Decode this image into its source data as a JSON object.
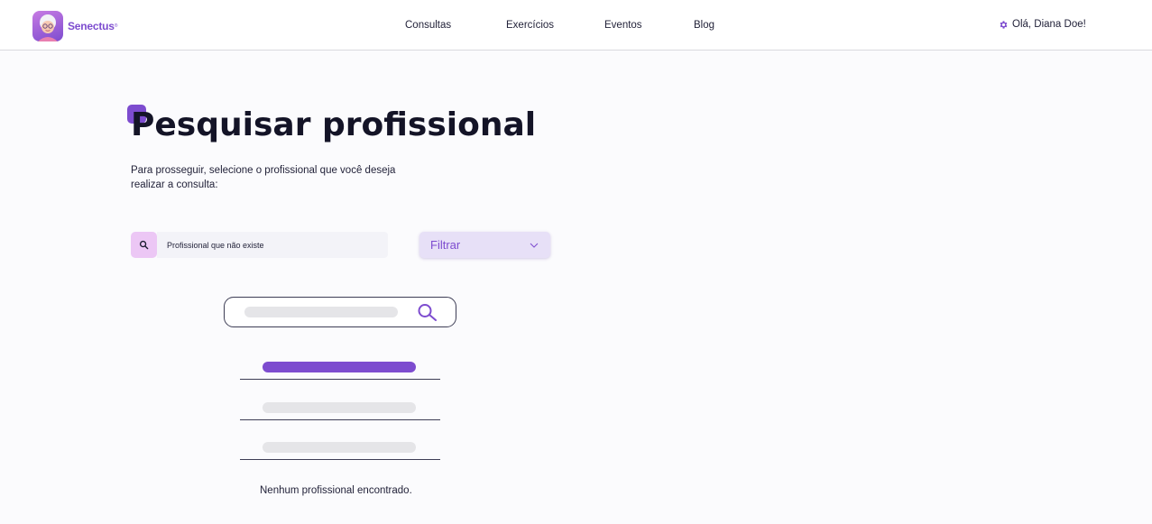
{
  "brand": {
    "name": "Senectus",
    "trademark": "®"
  },
  "nav": {
    "items": [
      {
        "label": "Consultas"
      },
      {
        "label": "Exercícios"
      },
      {
        "label": "Eventos"
      },
      {
        "label": "Blog"
      }
    ],
    "greeting": "Olá, Diana Doe!"
  },
  "page": {
    "title": "Pesquisar profissional",
    "subtitle": "Para prosseguir, selecione o profissional que você deseja realizar a consulta:"
  },
  "search": {
    "value": "Profissional que não existe",
    "icon": "search-icon"
  },
  "filter": {
    "label": "Filtrar",
    "icon": "chevron-down-icon"
  },
  "empty_state": {
    "message": "Nenhum profissional encontrado."
  },
  "colors": {
    "accent": "#7d4ccf",
    "search_button_bg": "#ecc7f5",
    "filter_bg": "#e7e0f7",
    "title": "#141427"
  }
}
